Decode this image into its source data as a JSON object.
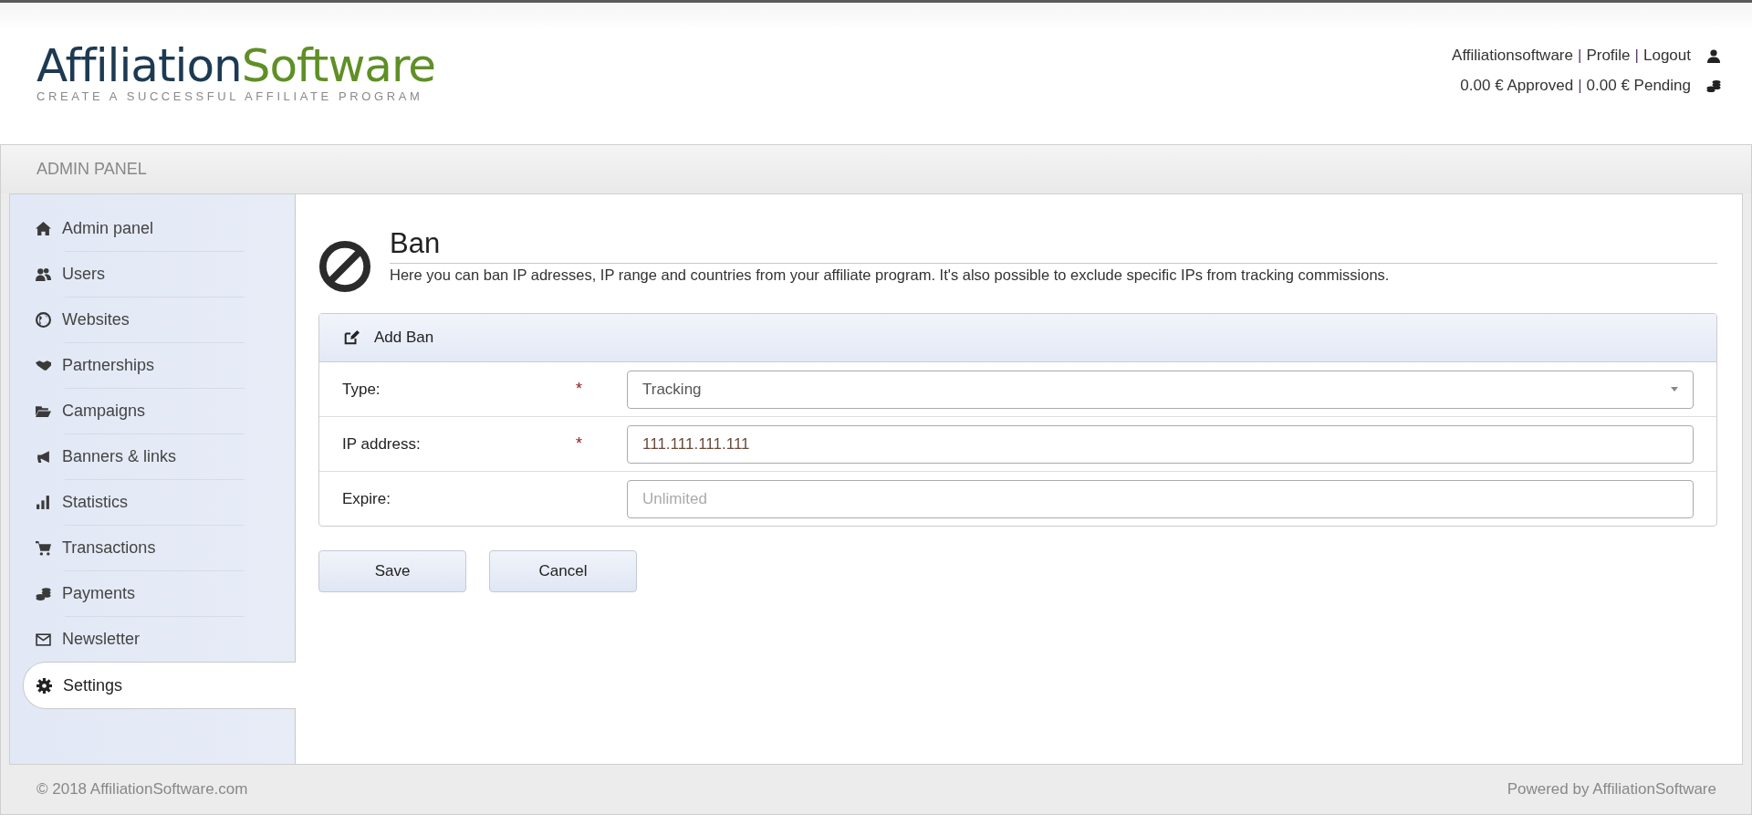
{
  "header": {
    "logo": {
      "part1": "Affiliation",
      "part2": "Software",
      "tagline": "CREATE A SUCCESSFUL AFFILIATE PROGRAM"
    },
    "user_links": [
      "Affiliationsoftware",
      "Profile",
      "Logout"
    ],
    "separator": "|",
    "balances": [
      "0.00 € Approved",
      "0.00 € Pending"
    ]
  },
  "panel_title": "ADMIN PANEL",
  "sidebar": {
    "items": [
      {
        "label": "Admin panel",
        "selected": false
      },
      {
        "label": "Users",
        "selected": false
      },
      {
        "label": "Websites",
        "selected": false
      },
      {
        "label": "Partnerships",
        "selected": false
      },
      {
        "label": "Campaigns",
        "selected": false
      },
      {
        "label": "Banners & links",
        "selected": false
      },
      {
        "label": "Statistics",
        "selected": false
      },
      {
        "label": "Transactions",
        "selected": false
      },
      {
        "label": "Payments",
        "selected": false
      },
      {
        "label": "Newsletter",
        "selected": false
      },
      {
        "label": "Settings",
        "selected": true
      }
    ]
  },
  "page": {
    "title": "Ban",
    "description": "Here you can ban IP adresses, IP range and countries from your affiliate program. It's also possible to exclude specific IPs from tracking commissions."
  },
  "form": {
    "title": "Add Ban",
    "fields": [
      {
        "kind": "select",
        "label": "Type:",
        "required": true,
        "value": "Tracking"
      },
      {
        "kind": "text",
        "label": "IP address:",
        "required": true,
        "value": "111.111.111.111"
      },
      {
        "kind": "text",
        "label": "Expire:",
        "required": false,
        "placeholder": "Unlimited"
      }
    ],
    "required_mark": "*",
    "buttons": [
      "Save",
      "Cancel"
    ]
  },
  "footer": {
    "copyright": "© 2018 AffiliationSoftware.com",
    "powered_by": "Powered by AffiliationSoftware"
  }
}
